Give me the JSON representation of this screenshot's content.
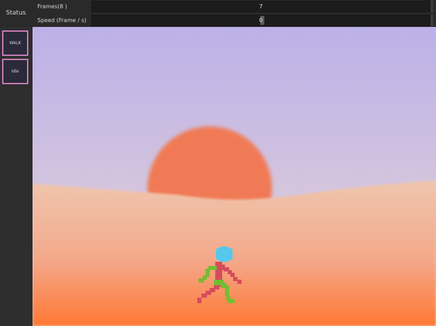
{
  "status": {
    "label": "Status"
  },
  "properties": [
    {
      "name": "Frames(8 )",
      "value": "7"
    },
    {
      "name": "Speed (Frame / s)",
      "value": "0"
    }
  ],
  "states": [
    {
      "label": "WALK"
    },
    {
      "label": "Idle"
    }
  ],
  "scene": {
    "sky_top": "#bcb0e8",
    "sky_bottom": "#e8d6d6",
    "sun_color": "#f07a54",
    "dune_top": "#efc6ae",
    "dune_bottom": "#ff7834",
    "character": {
      "head_color": "#56c8ec",
      "body_color": "#d44c5a",
      "limb_color": "#72be30"
    }
  }
}
